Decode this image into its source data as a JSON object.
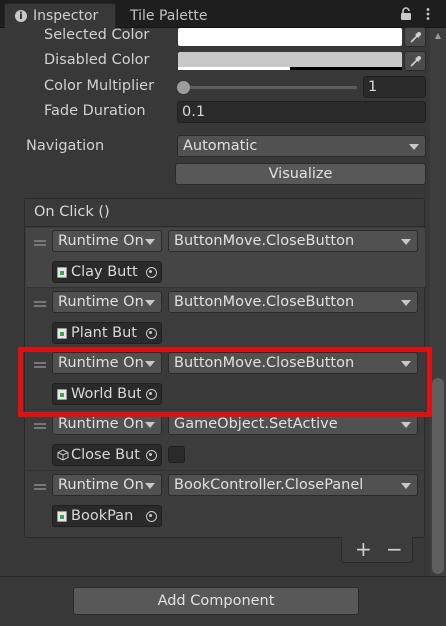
{
  "tabs": {
    "inspector": "Inspector",
    "tile_palette": "Tile Palette"
  },
  "props": {
    "selected_color_label": "Selected Color",
    "disabled_color_label": "Disabled Color",
    "color_multiplier_label": "Color Multiplier",
    "color_multiplier_value": "1",
    "color_multiplier_slider_fraction": 0.0,
    "fade_duration_label": "Fade Duration",
    "fade_duration_value": "0.1",
    "navigation_label": "Navigation",
    "navigation_value": "Automatic",
    "visualize_label": "Visualize"
  },
  "colors": {
    "selected_color": "#ffffff",
    "disabled_color": "#c8c8c8",
    "highlight_border": "#e01010"
  },
  "on_click": {
    "header": "On Click ()",
    "rows": [
      {
        "runtime": "Runtime On",
        "function": "ButtonMove.CloseButton",
        "object": "Clay Butt",
        "object_icon": "script-icon",
        "has_checkbox": false
      },
      {
        "runtime": "Runtime On",
        "function": "ButtonMove.CloseButton",
        "object": "Plant But",
        "object_icon": "script-icon",
        "has_checkbox": false
      },
      {
        "runtime": "Runtime On",
        "function": "ButtonMove.CloseButton",
        "object": "World But",
        "object_icon": "script-icon",
        "has_checkbox": false
      },
      {
        "runtime": "Runtime On",
        "function": "GameObject.SetActive",
        "object": "Close But",
        "object_icon": "cube-icon",
        "has_checkbox": true
      },
      {
        "runtime": "Runtime On",
        "function": "BookController.ClosePanel",
        "object": "BookPan",
        "object_icon": "script-icon",
        "has_checkbox": false
      }
    ],
    "plus": "+",
    "minus": "−"
  },
  "add_component_label": "Add Component"
}
